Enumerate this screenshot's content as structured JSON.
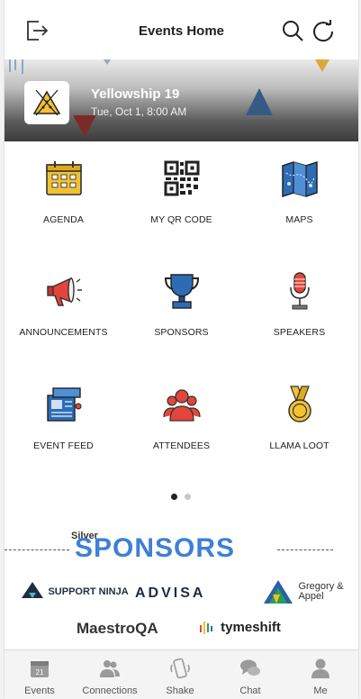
{
  "header": {
    "title": "Events Home",
    "icons": [
      "logout-icon",
      "search-icon",
      "refresh-icon"
    ]
  },
  "event": {
    "name": "Yellowship 19",
    "date": "Tue, Oct 1, 8:00 AM"
  },
  "grid": [
    {
      "label": "AGENDA",
      "icon": "calendar-icon"
    },
    {
      "label": "MY QR CODE",
      "icon": "qr-code-icon"
    },
    {
      "label": "MAPS",
      "icon": "map-icon"
    },
    {
      "label": "ANNOUNCEMENTS",
      "icon": "megaphone-icon"
    },
    {
      "label": "SPONSORS",
      "icon": "trophy-icon"
    },
    {
      "label": "SPEAKERS",
      "icon": "microphone-icon"
    },
    {
      "label": "EVENT FEED",
      "icon": "feed-icon"
    },
    {
      "label": "ATTENDEES",
      "icon": "people-icon"
    },
    {
      "label": "LLAMA LOOT",
      "icon": "medal-icon"
    }
  ],
  "pager": {
    "active": 0,
    "count": 2
  },
  "sponsors": {
    "tier": "Silver",
    "title": "SPONSORS",
    "logos": [
      "SUPPORT NINJA",
      "ADVISA",
      "Gregory & Appel",
      "MaestroQA",
      "tymeshift"
    ]
  },
  "tabs": [
    {
      "label": "Events",
      "icon": "calendar-tab-icon"
    },
    {
      "label": "Connections",
      "icon": "connections-icon"
    },
    {
      "label": "Shake",
      "icon": "shake-phone-icon"
    },
    {
      "label": "Chat",
      "icon": "chat-icon"
    },
    {
      "label": "Me",
      "icon": "person-icon"
    }
  ],
  "colors": {
    "accent_blue": "#3f7fd6",
    "icon_yellow": "#f2c233",
    "icon_red": "#e4453b",
    "icon_blue": "#2d6cb5"
  }
}
